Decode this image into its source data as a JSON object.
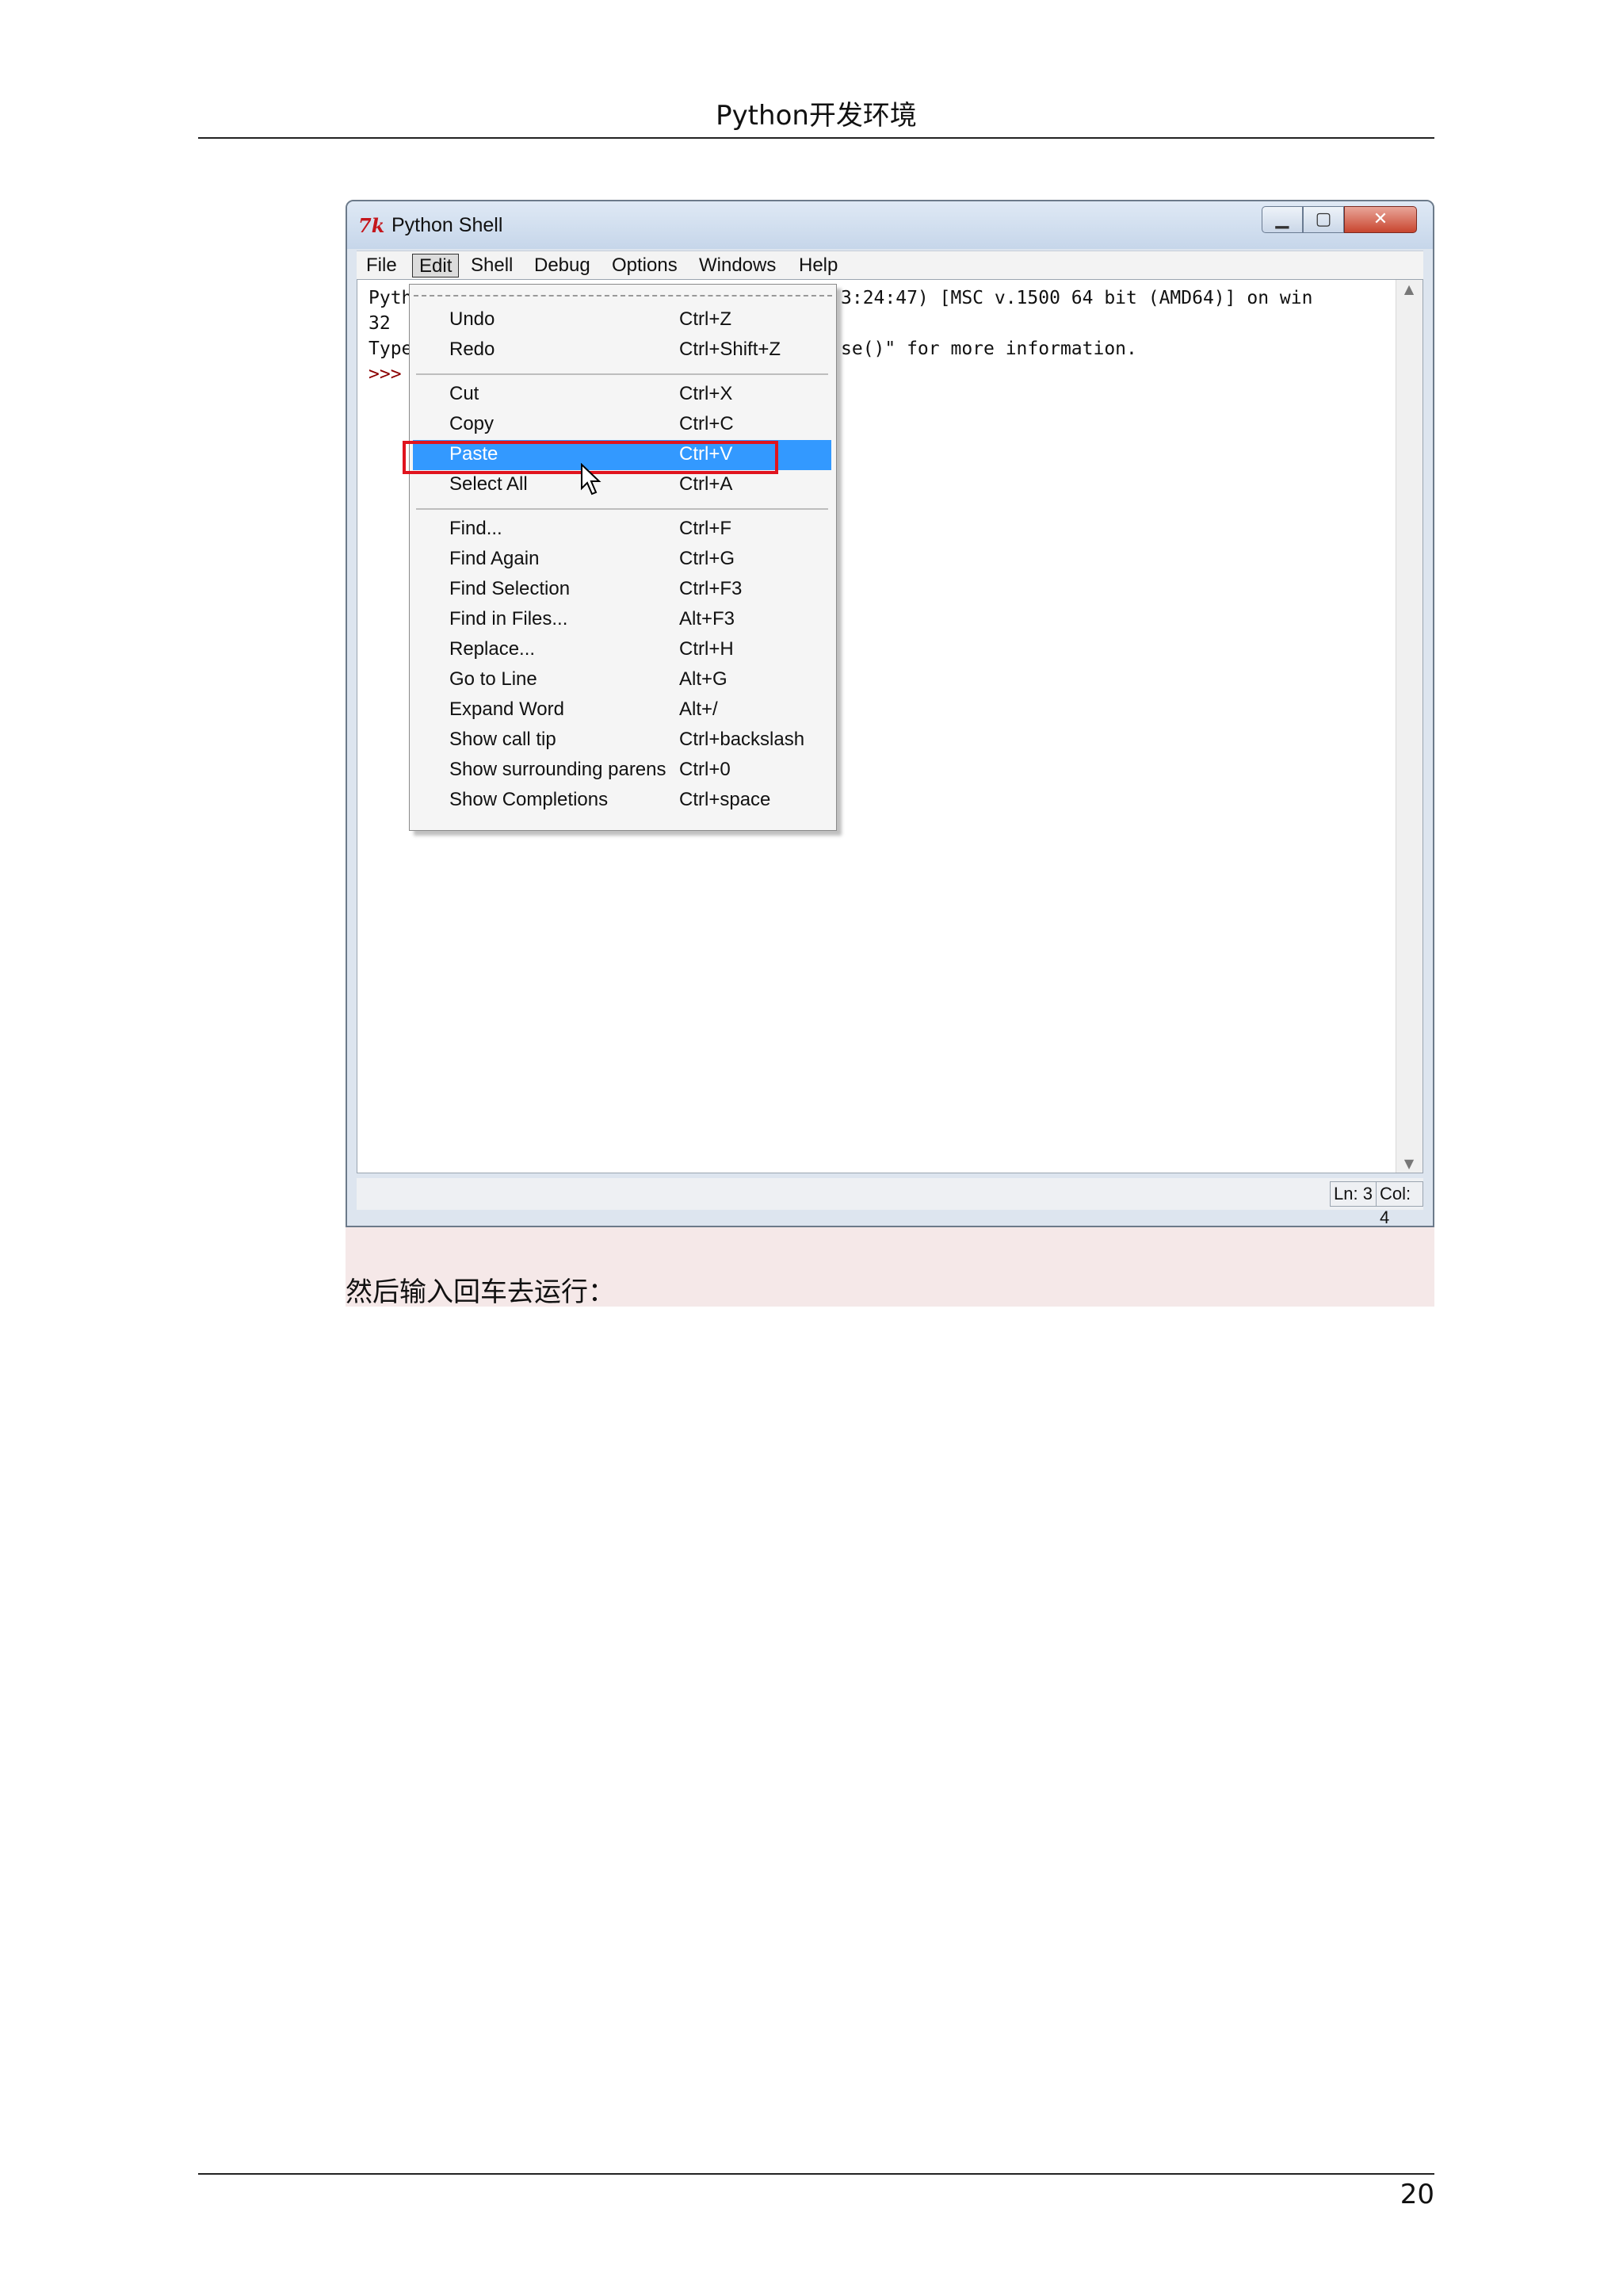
{
  "header": {
    "title": "Python开发环境"
  },
  "footer": {
    "page_number": "20"
  },
  "caption": "然后输入回车去运行：",
  "window": {
    "title": "Python Shell",
    "icon": "tk-icon",
    "menubar": [
      "File",
      "Edit",
      "Shell",
      "Debug",
      "Options",
      "Windows",
      "Help"
    ],
    "active_menu": "Edit",
    "shell_lines": [
      {
        "left": "Pyth",
        "right": "3:24:47) [MSC v.1500 64 bit (AMD64)] on win"
      },
      {
        "left": "32",
        "right": ""
      },
      {
        "left": "Type",
        "right": "se()\" for more information."
      },
      {
        "left": ">>>",
        "right": ""
      }
    ],
    "status": {
      "line": "Ln: 3",
      "col": "Col: 4"
    }
  },
  "edit_menu": {
    "groups": [
      [
        {
          "label": "Undo",
          "shortcut": "Ctrl+Z"
        },
        {
          "label": "Redo",
          "shortcut": "Ctrl+Shift+Z"
        }
      ],
      [
        {
          "label": "Cut",
          "shortcut": "Ctrl+X"
        },
        {
          "label": "Copy",
          "shortcut": "Ctrl+C"
        },
        {
          "label": "Paste",
          "shortcut": "Ctrl+V",
          "highlighted": true
        },
        {
          "label": "Select All",
          "shortcut": "Ctrl+A"
        }
      ],
      [
        {
          "label": "Find...",
          "shortcut": "Ctrl+F"
        },
        {
          "label": "Find Again",
          "shortcut": "Ctrl+G"
        },
        {
          "label": "Find Selection",
          "shortcut": "Ctrl+F3"
        },
        {
          "label": "Find in Files...",
          "shortcut": "Alt+F3"
        },
        {
          "label": "Replace...",
          "shortcut": "Ctrl+H"
        },
        {
          "label": "Go to Line",
          "shortcut": "Alt+G"
        },
        {
          "label": "Expand Word",
          "shortcut": "Alt+/"
        },
        {
          "label": "Show call tip",
          "shortcut": "Ctrl+backslash"
        },
        {
          "label": "Show surrounding parens",
          "shortcut": "Ctrl+0"
        },
        {
          "label": "Show Completions",
          "shortcut": "Ctrl+space"
        }
      ]
    ]
  },
  "colors": {
    "highlight": "#3399ff",
    "callout": "#e0141e",
    "prompt": "#8b0000"
  }
}
